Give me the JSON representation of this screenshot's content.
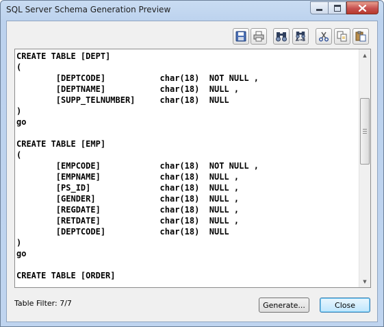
{
  "window": {
    "title": "SQL Server Schema Generation Preview"
  },
  "toolbar": {
    "icons": [
      "save-icon",
      "print-icon",
      "find-icon",
      "find-replace-icon",
      "cut-icon",
      "copy-icon",
      "paste-icon"
    ],
    "replace_label": "A→B"
  },
  "editor": {
    "lines": [
      "CREATE TABLE [DEPT]",
      "(",
      "        [DEPTCODE]           char(18)  NOT NULL ,",
      "        [DEPTNAME]           char(18)  NULL ,",
      "        [SUPP_TELNUMBER]     char(18)  NULL",
      ")",
      "go",
      "",
      "CREATE TABLE [EMP]",
      "(",
      "        [EMPCODE]            char(18)  NOT NULL ,",
      "        [EMPNAME]            char(18)  NULL ,",
      "        [PS_ID]              char(18)  NULL ,",
      "        [GENDER]             char(18)  NULL ,",
      "        [REGDATE]            char(18)  NULL ,",
      "        [RETDATE]            char(18)  NULL ,",
      "        [DEPTCODE]           char(18)  NULL",
      ")",
      "go",
      "",
      "CREATE TABLE [ORDER]"
    ]
  },
  "footer": {
    "filter_label": "Table Filter: 7/7",
    "generate_label": "Generate...",
    "close_label": "Close"
  }
}
